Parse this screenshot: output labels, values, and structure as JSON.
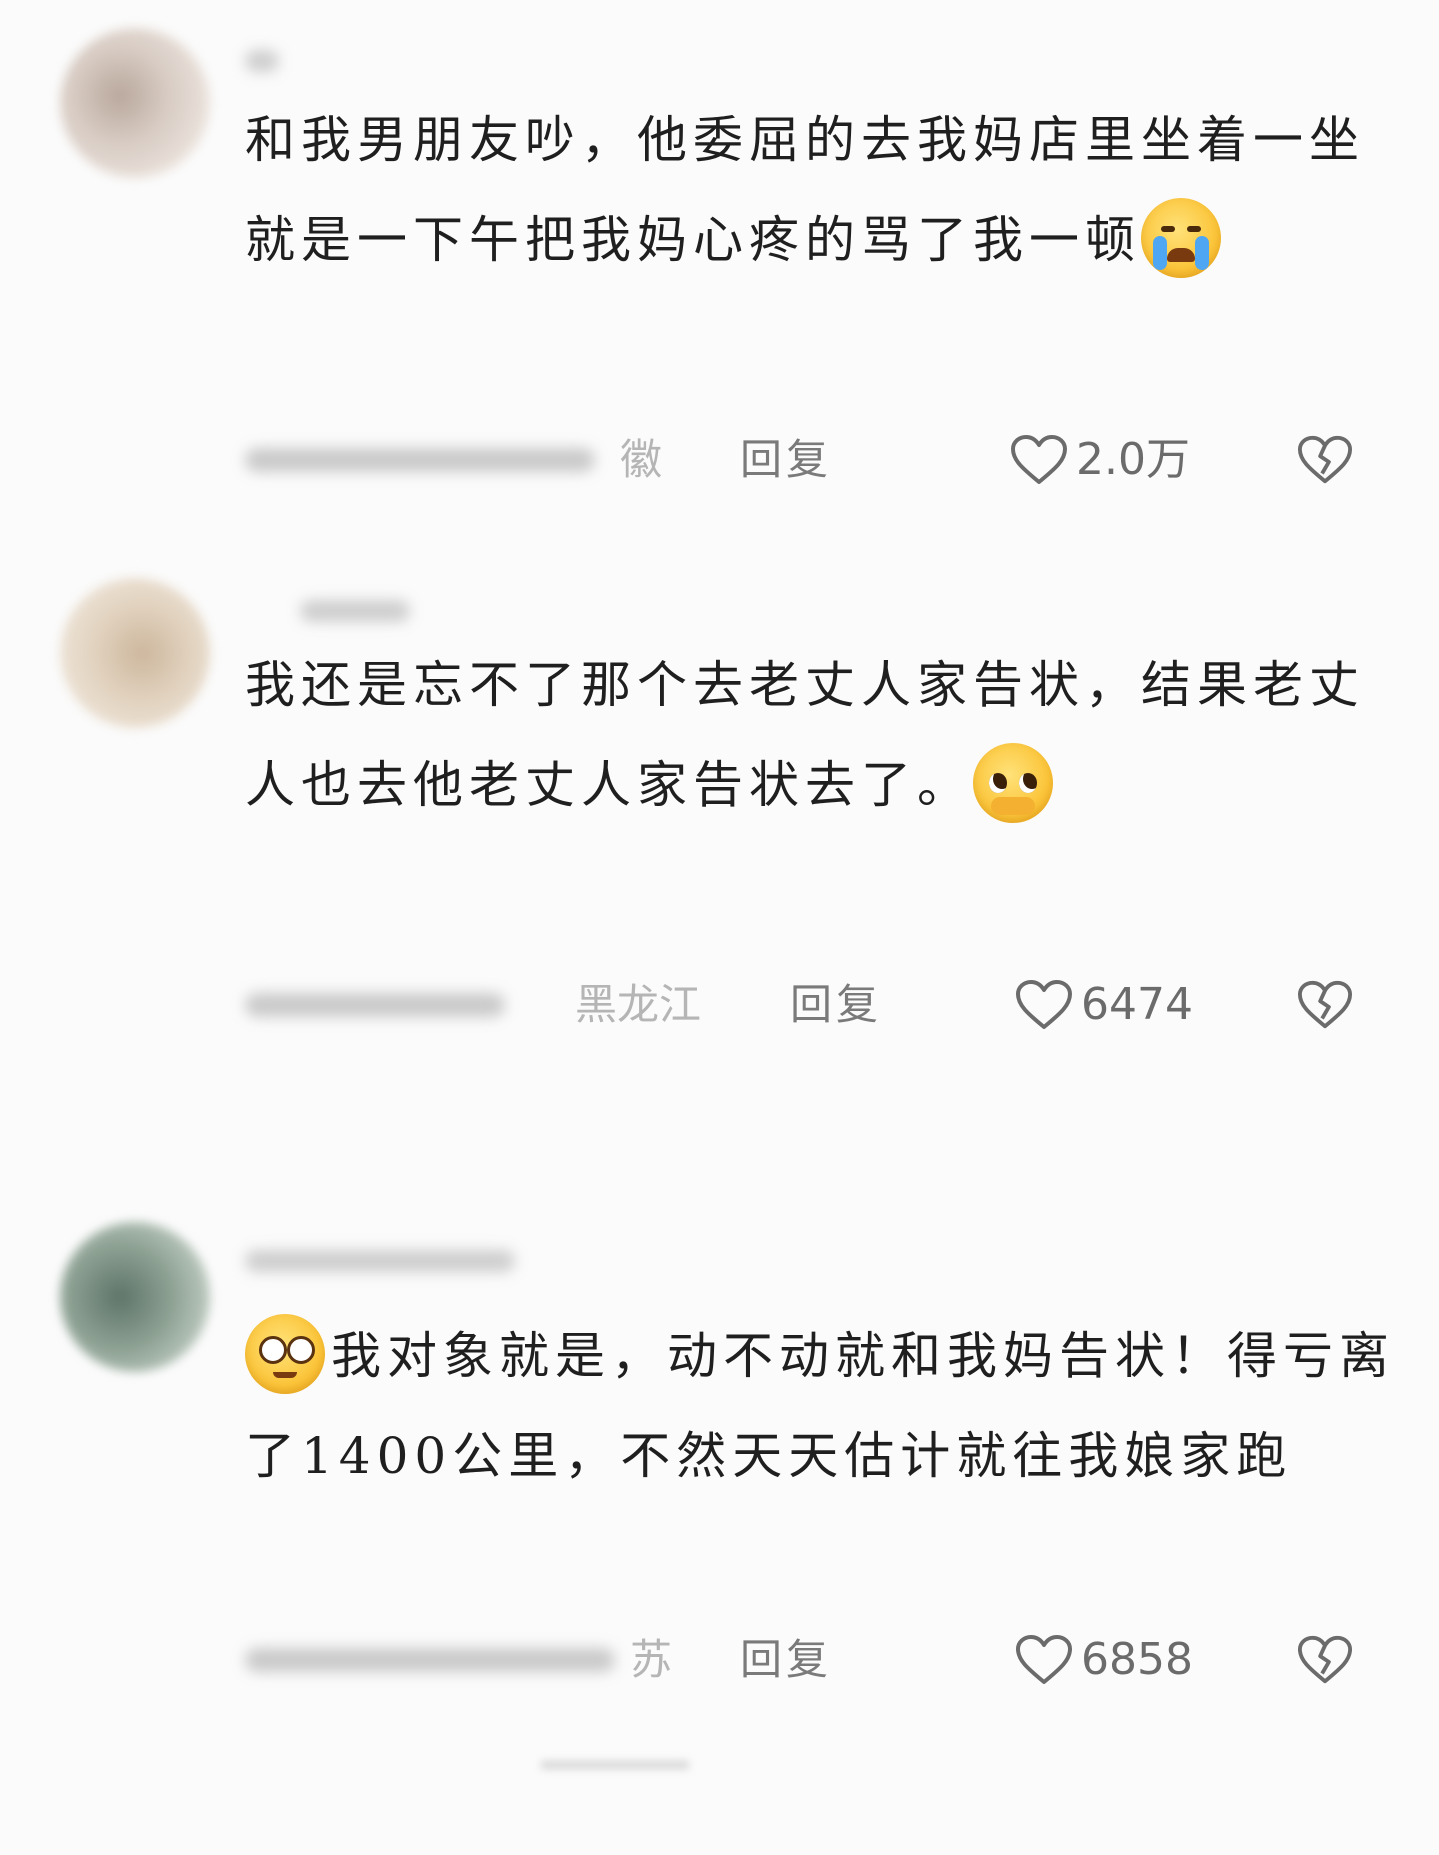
{
  "comments": [
    {
      "text_before": "",
      "text": "和我男朋友吵，他委屈的去我妈店里坐着一坐就是一下午把我妈心疼的骂了我一顿",
      "emoji_after": "loudly-crying-face-emoji",
      "location": "徽",
      "reply_label": "回复",
      "like_count": "2.0万"
    },
    {
      "text_before": "",
      "text": "我还是忘不了那个去老丈人家告状，结果老丈人也去他老丈人家告状去了。",
      "emoji_after": "pleading-face-emoji",
      "location": "黑龙江",
      "reply_label": "回复",
      "like_count": "6474"
    },
    {
      "text_before": "flushed-face-emoji",
      "text": "我对象就是，动不动就和我妈告状！得亏离了1400公里，不然天天估计就往我娘家跑",
      "emoji_after": "",
      "location": "苏",
      "reply_label": "回复",
      "like_count": "6858"
    }
  ],
  "icons": {
    "like": "heart-outline-icon",
    "dislike": "broken-heart-icon"
  },
  "colors": {
    "background": "#fbfbfb",
    "text": "#1f1f1f",
    "muted": "#7a7a7a",
    "location": "#b5b5b5"
  }
}
